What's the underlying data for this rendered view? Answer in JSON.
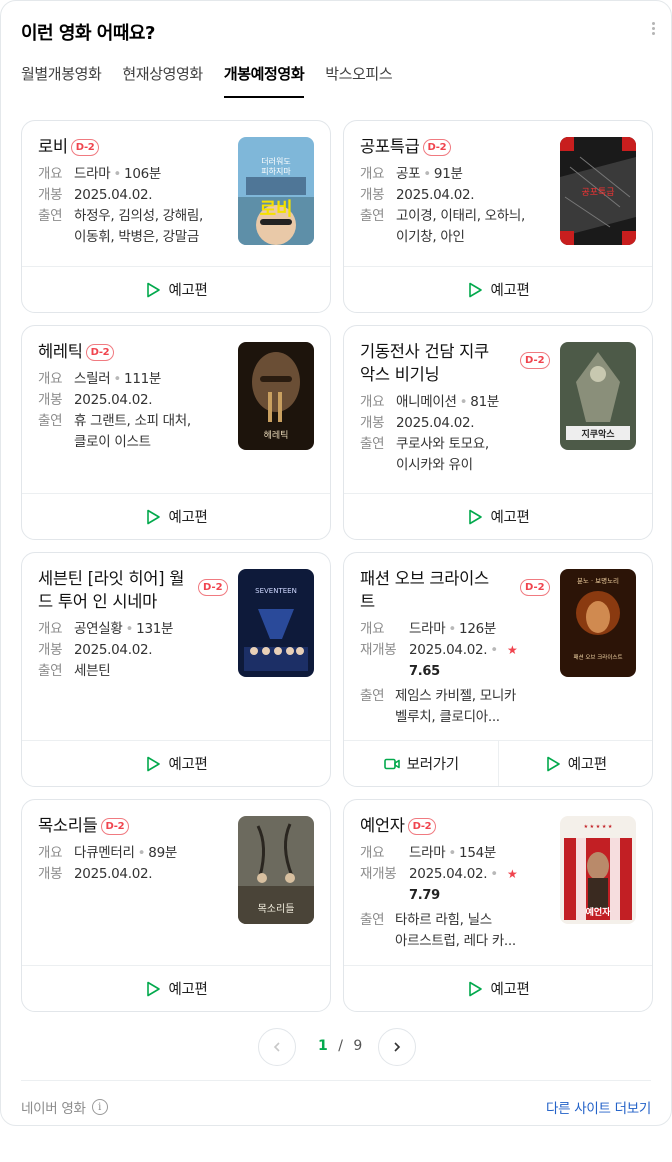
{
  "header": {
    "title": "이런 영화 어때요?"
  },
  "tabs": [
    "월별개봉영화",
    "현재상영영화",
    "개봉예정영화",
    "박스오피스"
  ],
  "labels": {
    "genre": "개요",
    "release": "개봉",
    "rerelease": "재개봉",
    "cast": "출연",
    "trailer": "예고편",
    "watch": "보러가기"
  },
  "movies": [
    {
      "title": "로비",
      "badge": "D-2",
      "genre": "드라마",
      "runtime": "106분",
      "date": "2025.04.02.",
      "cast1": "하정우, 김의성, 강해림,",
      "cast2": "이동휘, 박병은, 강말금",
      "poster_text": "로비"
    },
    {
      "title": "공포특급",
      "badge": "D-2",
      "genre": "공포",
      "runtime": "91분",
      "date": "2025.04.02.",
      "cast1": "고이경, 이태리, 오하늬,",
      "cast2": "이기창, 아인",
      "poster_text": "공포특급"
    },
    {
      "title": "헤레틱",
      "badge": "D-2",
      "genre": "스릴러",
      "runtime": "111분",
      "date": "2025.04.02.",
      "cast1": "휴 그랜트, 소피 대처,",
      "cast2": "클로이 이스트",
      "poster_text": "헤레틱"
    },
    {
      "title1": "기동전사 건담 지쿠",
      "title2": "악스 비기닝",
      "badge": "D-2",
      "genre": "애니메이션",
      "runtime": "81분",
      "date": "2025.04.02.",
      "cast1": "쿠로사와 토모요,",
      "cast2": "이시카와 유이",
      "poster_text": "지쿠악스"
    },
    {
      "title1": "세븐틴 [라잇 히어] 월",
      "title2": "드 투어 인 시네마",
      "badge": "D-2",
      "genre": "공연실황",
      "runtime": "131분",
      "date": "2025.04.02.",
      "cast1": "세븐틴",
      "poster_text": "SEVENTEEN"
    },
    {
      "title1": "패션 오브 크라이스",
      "title2": "트",
      "badge": "D-2",
      "genre": "드라마",
      "runtime": "126분",
      "date": "2025.04.02.",
      "score": "7.65",
      "cast1": "제임스 카비젤, 모니카",
      "cast2": "벨루치, 클로디아...",
      "poster_top": "분노 · 보명노리",
      "poster_text": "패션 오브 크라이스트"
    },
    {
      "title": "목소리들",
      "badge": "D-2",
      "genre": "다큐멘터리",
      "runtime": "89분",
      "date": "2025.04.02.",
      "poster_text": "목소리들"
    },
    {
      "title": "예언자",
      "badge": "D-2",
      "genre": "드라마",
      "runtime": "154분",
      "date": "2025.04.02.",
      "score": "7.79",
      "cast1": "타하르 라힘, 닐스",
      "cast2": "아르스트럽, 레다 카...",
      "poster_text": "예언자"
    }
  ],
  "pager": {
    "current": "1",
    "sep": "/",
    "total": "9"
  },
  "footer": {
    "source": "네이버 영화",
    "more": "다른 사이트 더보기"
  },
  "colors": {
    "accent_green": "#03a94d",
    "badge_red": "#f0444e",
    "link_blue": "#2362c8"
  }
}
